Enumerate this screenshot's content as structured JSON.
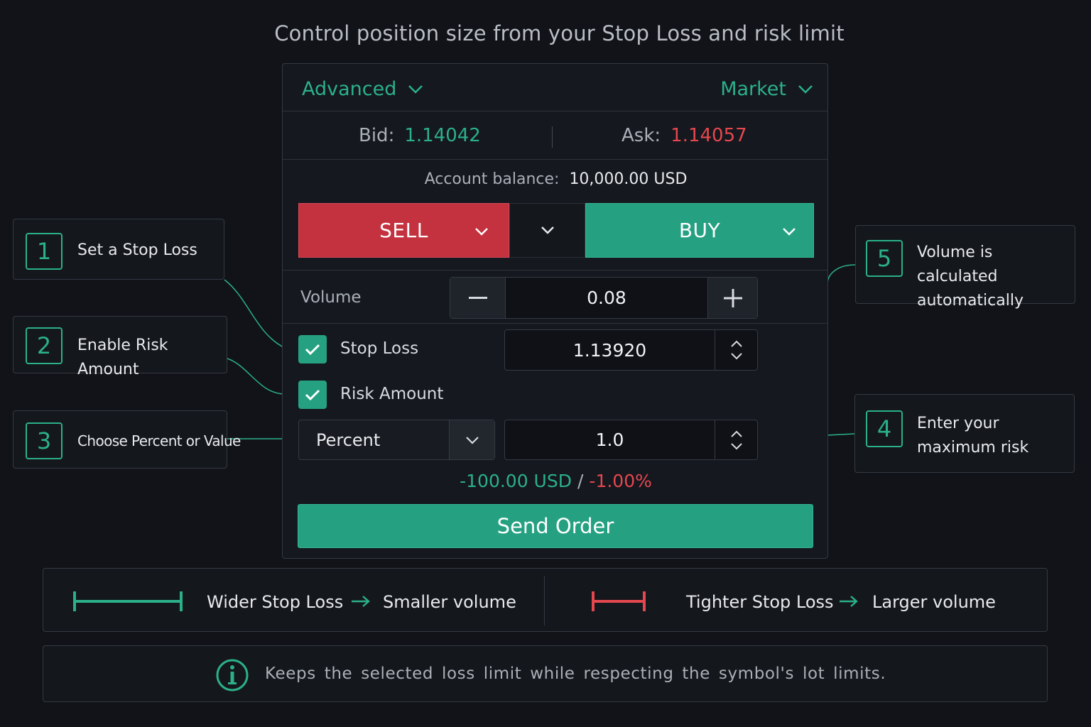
{
  "headline": "Control position size from your Stop Loss and risk limit",
  "panel": {
    "mode_dropdown": "Advanced",
    "order_type_dropdown": "Market",
    "bid_label": "Bid:",
    "bid_value": "1.14042",
    "ask_label": "Ask:",
    "ask_value": "1.14057",
    "balance_label": "Account balance:",
    "balance_value": "10,000.00 USD",
    "sell_label": "SELL",
    "buy_label": "BUY",
    "volume_label": "Volume",
    "volume_value": "0.08",
    "stop_loss_label": "Stop Loss",
    "stop_loss_checked": true,
    "stop_loss_value": "1.13920",
    "risk_amount_label": "Risk Amount",
    "risk_amount_checked": true,
    "risk_mode_selected": "Percent",
    "risk_value": "1.0",
    "risk_usd": "-100.00 USD",
    "risk_separator": "/",
    "risk_pct": "-1.00%",
    "send_label": "Send Order"
  },
  "callouts": [
    {
      "num": "1",
      "text": "Set a Stop Loss"
    },
    {
      "num": "2",
      "text": "Enable Risk Amount"
    },
    {
      "num": "3",
      "text": "Choose Percent or Value"
    },
    {
      "num": "4",
      "line1": "Enter your",
      "line2": "maximum risk"
    },
    {
      "num": "5",
      "line1": "Volume is calculated",
      "line2": "automatically"
    }
  ],
  "legend": {
    "wide_label": "Wider Stop Loss",
    "wide_result": "Smaller volume",
    "tight_label": "Tighter Stop Loss",
    "tight_result": "Larger volume"
  },
  "info_text": "Keeps the selected loss limit while respecting the symbol's lot limits.",
  "colors": {
    "accent_green": "#2bb08a",
    "button_green": "#25a182",
    "sell_red": "#c4313f",
    "ask_red": "#e5474f",
    "background": "#111318"
  },
  "icons": [
    "chevron-down-icon",
    "minus-icon",
    "plus-icon",
    "checkmark-icon",
    "spin-arrows-icon",
    "arrow-right-icon",
    "info-icon"
  ]
}
